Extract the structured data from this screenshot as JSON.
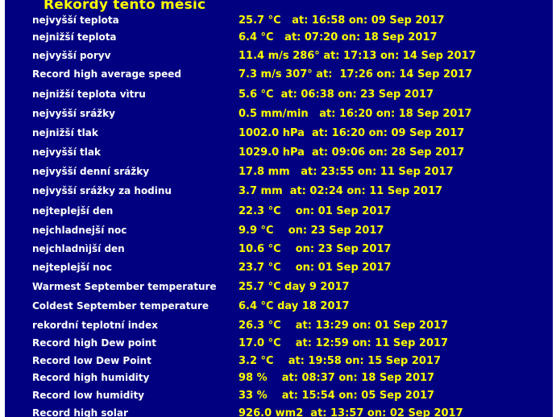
{
  "title": "Rekordy tento měsíc",
  "colors": {
    "background": "#000080",
    "label": "#ffffff",
    "value": "#ffff00"
  },
  "records": [
    {
      "label": "nejvyšší teplota",
      "value": "25.7 °C   at: 16:58 on: 09 Sep 2017"
    },
    {
      "label": "nejnižší teplota",
      "value": "6.4 °C   at: 07:20 on: 18 Sep 2017"
    },
    {
      "label": "nejvyšší poryv",
      "value": "11.4 m/s 286° at: 17:13 on: 14 Sep 2017"
    },
    {
      "label": "Record high average speed",
      "value": "7.3 m/s 307° at:  17:26 on: 14 Sep 2017"
    },
    {
      "label": "nejnižší teplota vìtru",
      "value": "5.6 °C  at: 06:38 on: 23 Sep 2017"
    },
    {
      "label": "nejvyšší srážky",
      "value": "0.5 mm/min   at: 16:20 on: 18 Sep 2017"
    },
    {
      "label": "nejnižší tlak",
      "value": "1002.0 hPa  at: 16:20 on: 09 Sep 2017"
    },
    {
      "label": "nejvyšší tlak",
      "value": "1029.0 hPa  at: 09:06 on: 28 Sep 2017"
    },
    {
      "label": "nejvyšší denní srážky",
      "value": "17.8 mm   at: 23:55 on: 11 Sep 2017"
    },
    {
      "label": "nejvyšší srážky za hodinu",
      "value": "3.7 mm  at: 02:24 on: 11 Sep 2017"
    },
    {
      "label": "nejteplejší den",
      "value": "22.3 °C    on: 01 Sep 2017"
    },
    {
      "label": "nejchladnejší noc",
      "value": "9.9 °C    on: 23 Sep 2017"
    },
    {
      "label": "nejchladnìjší den",
      "value": "10.6 °C    on: 23 Sep 2017"
    },
    {
      "label": "nejteplejší noc",
      "value": "23.7 °C    on: 01 Sep 2017"
    },
    {
      "label": "Warmest September temperature",
      "value": "25.7 °C day 9 2017"
    },
    {
      "label": "Coldest September temperature",
      "value": "6.4 °C day 18 2017"
    },
    {
      "label": "rekordní teplotní index",
      "value": "26.3 °C    at: 13:29 on: 01 Sep 2017"
    },
    {
      "label": "Record high Dew point",
      "value": "17.0 °C    at: 12:59 on: 11 Sep 2017"
    },
    {
      "label": "Record low Dew Point",
      "value": "3.2 °C    at: 19:58 on: 15 Sep 2017"
    },
    {
      "label": "Record high humidity",
      "value": "98 %    at: 08:37 on: 18 Sep 2017"
    },
    {
      "label": "Record low humidity",
      "value": "33 %    at: 15:54 on: 05 Sep 2017"
    },
    {
      "label": "Record high solar",
      "value": "926.0 wm2  at: 13:57 on: 02 Sep 2017"
    }
  ]
}
